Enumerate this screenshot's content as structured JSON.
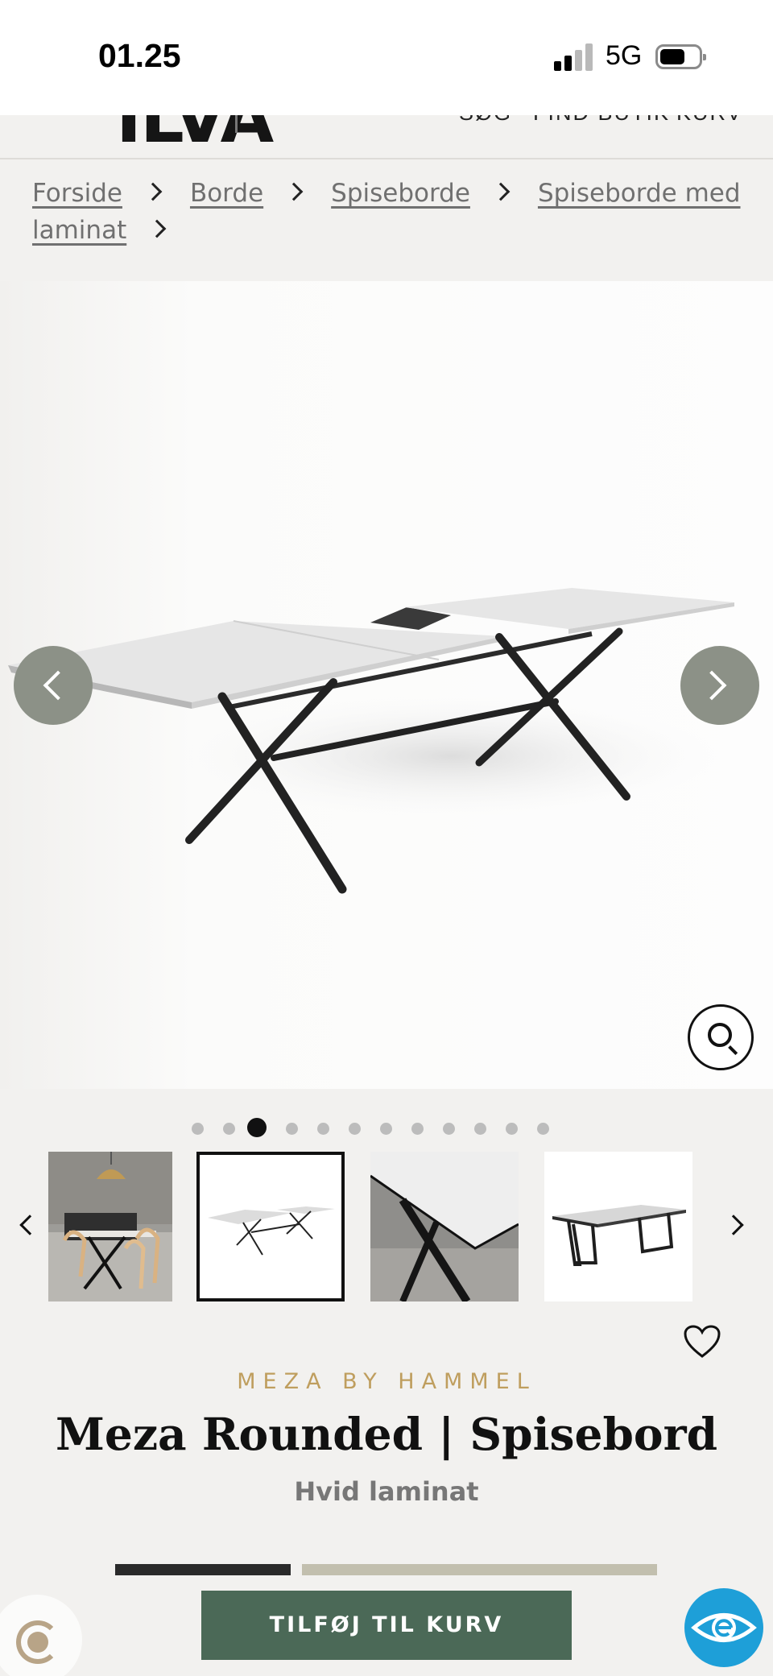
{
  "status_bar": {
    "time": "01.25",
    "network": "5G",
    "signal_bars_filled": 2,
    "signal_bars_total": 4
  },
  "header": {
    "logo": "ILVA",
    "nav": {
      "search": "SØG",
      "find_store": "FIND BUTIK",
      "cart": "KURV"
    }
  },
  "breadcrumb": {
    "items": [
      "Forside",
      "Borde",
      "Spiseborde",
      "Spiseborde med",
      "laminat"
    ]
  },
  "gallery": {
    "prev_icon": "chevron-left-icon",
    "next_icon": "chevron-right-icon",
    "zoom_icon": "search-icon",
    "dot_count": 12,
    "active_dot": 3,
    "thumbnails": [
      "lifestyle-dining",
      "extended-table",
      "leg-detail",
      "frame-table"
    ],
    "selected_thumbnail": 2
  },
  "product": {
    "brand": "MEZA BY HAMMEL",
    "title": "Meza Rounded | Spisebord",
    "variant": "Hvid laminat",
    "favorite_icon": "heart-icon"
  },
  "actions": {
    "add_to_cart": "TILFØJ TIL KURV",
    "eye_icon": "eye-icon",
    "recycle_icon": "recycle-icon"
  },
  "colors": {
    "cart_button": "#4b6957",
    "brand_text": "#bf9e5e",
    "arrow_buttons": "#8c9187",
    "eye_button": "#1e9fd8"
  }
}
